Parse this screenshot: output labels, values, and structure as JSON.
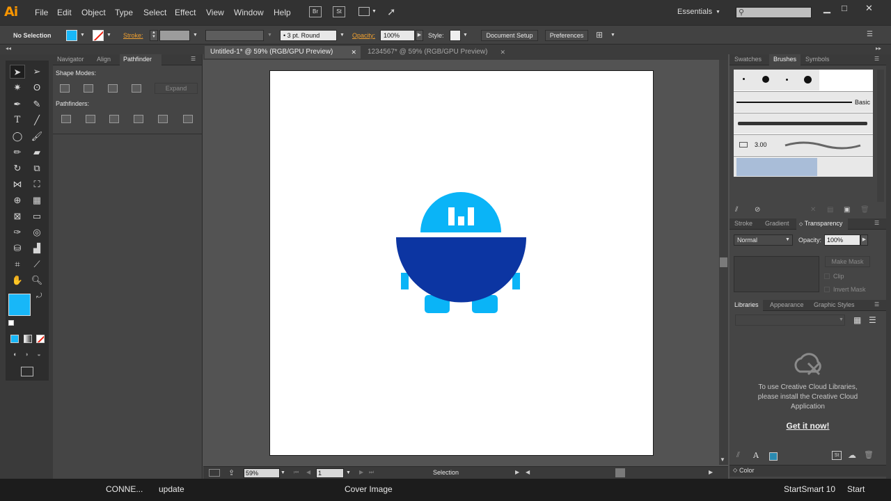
{
  "app": {
    "logo": "Ai"
  },
  "menu": [
    "File",
    "Edit",
    "Object",
    "Type",
    "Select",
    "Effect",
    "View",
    "Window",
    "Help"
  ],
  "menu_buttons": {
    "bridge": "Br",
    "stock": "St"
  },
  "workspace": {
    "label": "Essentials"
  },
  "search": {
    "placeholder": ""
  },
  "controlbar": {
    "selection": "No Selection",
    "stroke_label": "Stroke:",
    "brush": "3 pt. Round",
    "opacity_label": "Opacity:",
    "opacity_value": "100%",
    "style_label": "Style:",
    "document_setup": "Document Setup",
    "preferences": "Preferences"
  },
  "leftpanel": {
    "tabs": [
      "Navigator",
      "Align",
      "Pathfinder"
    ],
    "shape_modes": "Shape Modes:",
    "expand": "Expand",
    "pathfinders": "Pathfinders:"
  },
  "doc_tabs": [
    "Untitled-1* @ 59% (RGB/GPU Preview)",
    "1234567* @ 59% (RGB/GPU Preview)"
  ],
  "status": {
    "zoom": "59%",
    "page": "1",
    "tool": "Selection"
  },
  "brushes_panel": {
    "tabs": [
      "Swatches",
      "Brushes",
      "Symbols"
    ],
    "basic": "Basic",
    "size": "3.00"
  },
  "transparency_panel": {
    "tabs": [
      "Stroke",
      "Gradient",
      "Transparency"
    ],
    "blend_mode": "Normal",
    "opacity_label": "Opacity:",
    "opacity_value": "100%",
    "make_mask": "Make Mask",
    "clip": "Clip",
    "invert_mask": "Invert Mask"
  },
  "libraries_panel": {
    "tabs": [
      "Libraries",
      "Appearance",
      "Graphic Styles"
    ],
    "message": [
      "To use Creative Cloud Libraries,",
      "please install the Creative Cloud",
      "Application"
    ],
    "link": "Get it now!"
  },
  "color_panel": {
    "label": "Color"
  },
  "taskbar": [
    "CONNE...",
    "update",
    "Cover Image",
    "StartSmart 10",
    "Start"
  ],
  "colors": {
    "fill": "#18b7f8",
    "robot_head": "#0ab4f7",
    "robot_body": "#0c35a2",
    "accent_orange": "#f79500"
  },
  "icons": [
    "selection-tool-icon",
    "direct-selection-tool-icon",
    "pen-tool-icon",
    "type-tool-icon",
    "zoom-tool-icon",
    "hand-tool-icon",
    "creative-cloud-icon"
  ]
}
